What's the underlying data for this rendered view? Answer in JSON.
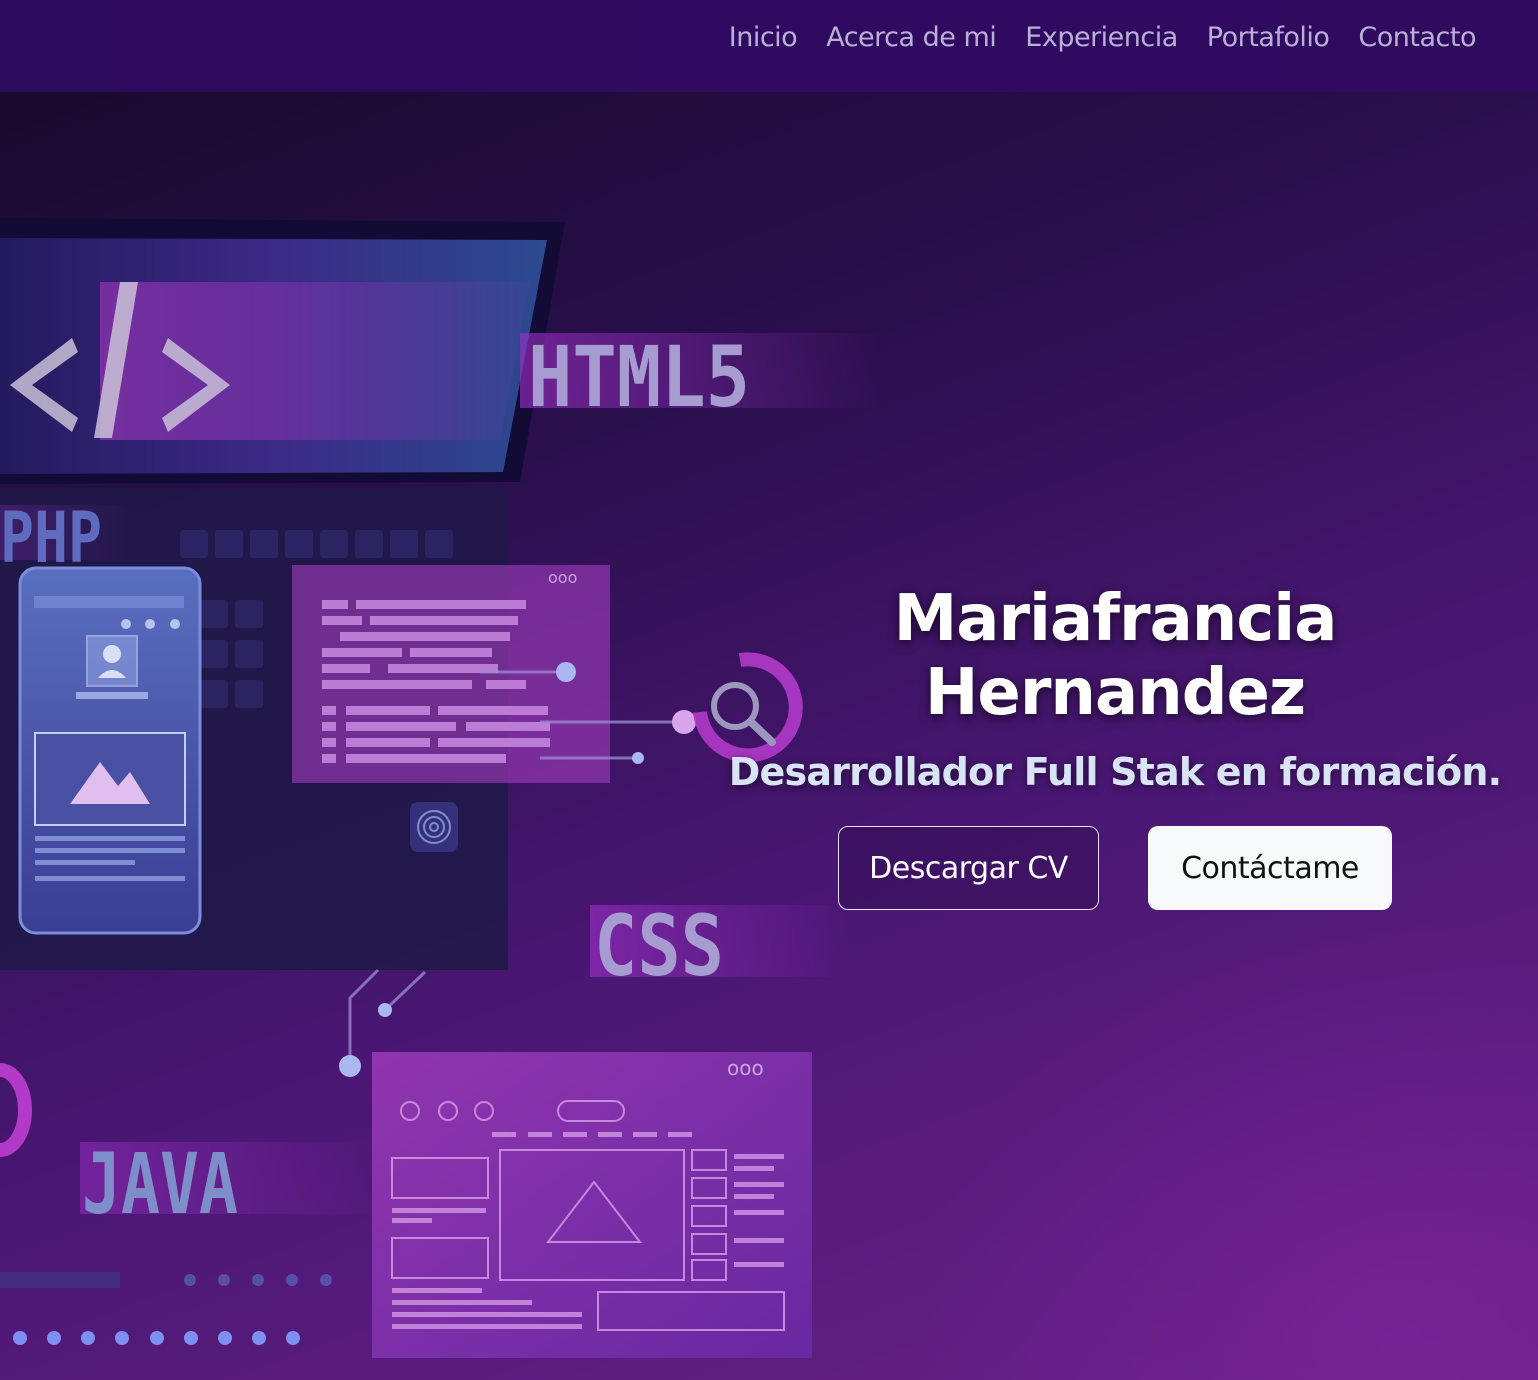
{
  "nav": {
    "links": [
      "Inicio",
      "Acerca de mi",
      "Experiencia",
      "Portafolio",
      "Contacto"
    ]
  },
  "hero": {
    "name": "Mariafrancia Hernandez",
    "role": "Desarrollador Full Stak en formación.",
    "buttons": {
      "download_cv": "Descargar CV",
      "contact": "Contáctame"
    },
    "illustration": {
      "labels": [
        "HTML5",
        "PHP",
        "CSS",
        "JAVA"
      ],
      "code_symbol": "</>",
      "window_dots": "ooo"
    }
  },
  "colors": {
    "navbar": "#2c0a5c",
    "nav_text": "#b9b0d6",
    "name_text": "#ffffff",
    "role_text": "#d8e4f5",
    "accent_magenta": "#b23ac9",
    "button_solid_bg": "#f8f9fa"
  }
}
